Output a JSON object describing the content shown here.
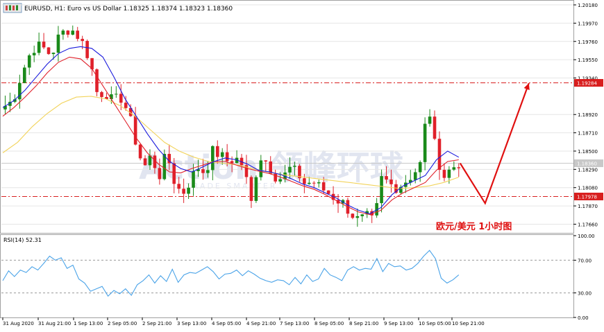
{
  "header": {
    "title": "EURUSD, H1:  Euro vs US Dollar  1.18325 1.18374 1.18323 1.18360"
  },
  "annotation": {
    "label": "欧元/美元   1小时图"
  },
  "watermark": {
    "text": "Action 领峰环球",
    "subtext": "TRADE SMARTER"
  },
  "colors": {
    "bull": "#1a8a1a",
    "bear": "#e0202a",
    "ma_fast": "#1a1adc",
    "ma_mid": "#e0202a",
    "ma_slow": "#f2d35a",
    "rsi": "#4aa3e8",
    "level": "#d81e1e",
    "arrow": "#e01010",
    "current_price_bg": "#c8c8c8"
  },
  "chart_data": [
    {
      "type": "candlestick",
      "title": "EURUSD, H1:  Euro vs US Dollar  1.18325 1.18374 1.18323 1.18360",
      "symbol": "EURUSD",
      "timeframe": "H1",
      "ylim": [
        1.1756,
        1.2022
      ],
      "y_ticks": [
        1.2018,
        1.1997,
        1.1976,
        1.1955,
        1.1934,
        1.1892,
        1.1871,
        1.185,
        1.1829,
        1.1808,
        1.1787,
        1.1766
      ],
      "x_ticks": [
        "31 Aug 2020",
        "31 Aug 21:00",
        "1 Sep 13:00",
        "2 Sep 05:00",
        "2 Sep 21:00",
        "3 Sep 13:00",
        "4 Sep 05:00",
        "4 Sep 21:00",
        "7 Sep 13:00",
        "8 Sep 05:00",
        "8 Sep 21:00",
        "9 Sep 13:00",
        "10 Sep 05:00",
        "10 Sep 21:00"
      ],
      "price_labels": [
        {
          "name": "resistance",
          "value": 1.19284,
          "text": "1.19284"
        },
        {
          "name": "current",
          "value": 1.1836,
          "text": "1.18360"
        },
        {
          "name": "support",
          "value": 1.17978,
          "text": "1.17978"
        }
      ],
      "horizontal_levels": [
        1.19284,
        1.17978
      ],
      "close_path": [
        1.1902,
        1.1908,
        1.1935,
        1.1958,
        1.1972,
        1.1968,
        1.196,
        1.1982,
        1.199,
        1.1988,
        1.1975,
        1.1955,
        1.1915,
        1.1918,
        1.1907,
        1.1912,
        1.1895,
        1.186,
        1.183,
        1.1845,
        1.182,
        1.1848,
        1.1815,
        1.18,
        1.1815,
        1.1832,
        1.1825,
        1.185,
        1.1845,
        1.1838,
        1.1842,
        1.1833,
        1.179,
        1.1845,
        1.1838,
        1.1822,
        1.1818,
        1.183,
        1.1825,
        1.1812,
        1.1815,
        1.1808,
        1.1802,
        1.1795,
        1.179,
        1.1778,
        1.177,
        1.1775,
        1.1768,
        1.182,
        1.1812,
        1.1808,
        1.1815,
        1.1823,
        1.1835,
        1.1906,
        1.185,
        1.182,
        1.183,
        1.1836
      ],
      "forecast_path": [
        1.1836,
        1.179,
        1.1928
      ],
      "ma_fast_path": [
        1.19,
        1.1908,
        1.192,
        1.1935,
        1.195,
        1.1962,
        1.1968,
        1.197,
        1.1968,
        1.1958,
        1.1935,
        1.191,
        1.189,
        1.187,
        1.1852,
        1.1838,
        1.183,
        1.1826,
        1.1832,
        1.1838,
        1.1842,
        1.184,
        1.1835,
        1.1828,
        1.1826,
        1.1823,
        1.1818,
        1.1812,
        1.1808,
        1.1802,
        1.1796,
        1.1788,
        1.1782,
        1.1778,
        1.1785,
        1.18,
        1.181,
        1.1816,
        1.1822,
        1.184,
        1.185,
        1.1843
      ],
      "ma_mid_path": [
        1.189,
        1.19,
        1.1912,
        1.1925,
        1.194,
        1.1952,
        1.1958,
        1.1956,
        1.1945,
        1.1925,
        1.1905,
        1.1885,
        1.1865,
        1.1848,
        1.1835,
        1.1826,
        1.1825,
        1.183,
        1.1834,
        1.1838,
        1.1838,
        1.1834,
        1.183,
        1.1827,
        1.1824,
        1.182,
        1.1815,
        1.181,
        1.1806,
        1.18,
        1.1793,
        1.1786,
        1.178,
        1.1777,
        1.1782,
        1.1794,
        1.1802,
        1.1808,
        1.1814,
        1.1828,
        1.1838,
        1.184
      ],
      "ma_slow_path": [
        1.1848,
        1.186,
        1.1878,
        1.1893,
        1.1905,
        1.1912,
        1.1913,
        1.191,
        1.1902,
        1.189,
        1.1875,
        1.186,
        1.185,
        1.1843,
        1.1838,
        1.1836,
        1.1834,
        1.183,
        1.1826,
        1.1823,
        1.1821,
        1.1819,
        1.1817,
        1.1815,
        1.1813,
        1.1811,
        1.1809,
        1.1807,
        1.1808,
        1.181,
        1.1814,
        1.182
      ]
    },
    {
      "type": "line",
      "title": "RSI(14) 52.31",
      "series": [
        {
          "name": "RSI(14)",
          "last": 52.31
        }
      ],
      "ylim": [
        0,
        100
      ],
      "y_ticks": [
        100.0,
        70.0,
        30.0,
        0.0
      ],
      "levels": [
        70,
        30
      ],
      "values": [
        45,
        57,
        50,
        58,
        55,
        62,
        58,
        66,
        75,
        70,
        73,
        60,
        64,
        47,
        42,
        32,
        35,
        38,
        26,
        33,
        29,
        35,
        27,
        40,
        45,
        52,
        42,
        51,
        44,
        59,
        43,
        52,
        55,
        54,
        58,
        62,
        56,
        47,
        53,
        54,
        58,
        51,
        57,
        53,
        48,
        45,
        43,
        46,
        45,
        40,
        49,
        41,
        52,
        44,
        47,
        60,
        52,
        49,
        45,
        58,
        62,
        58,
        60,
        59,
        72,
        56,
        66,
        62,
        63,
        58,
        60,
        66,
        75,
        82,
        72,
        48,
        42,
        46,
        52
      ]
    }
  ]
}
